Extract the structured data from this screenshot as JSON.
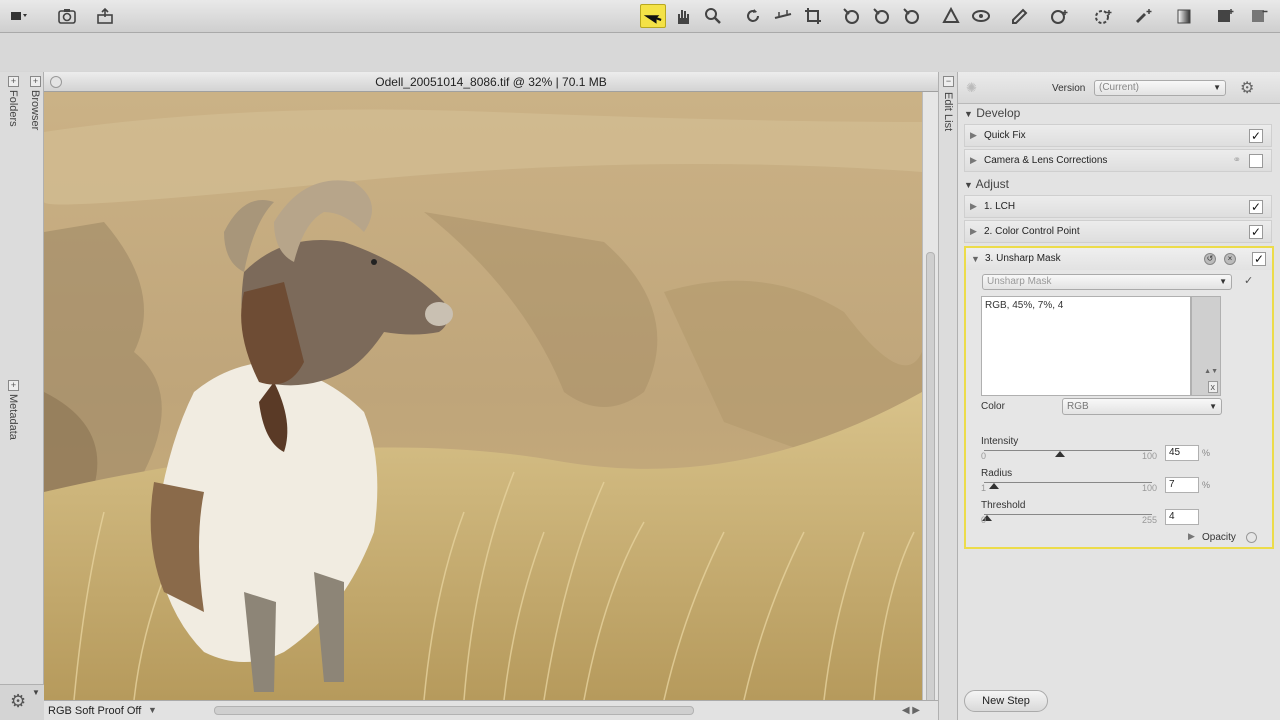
{
  "toolbar": {
    "left_icons": [
      "view-mode-icon",
      "snapshot-icon",
      "print-icon"
    ],
    "tools": [
      "direct-selection-tool-icon",
      "hand-tool-icon",
      "zoom-tool-icon",
      "rotate-tool-icon",
      "straighten-tool-icon",
      "crop-tool-icon",
      "red-eye-tool-icon",
      "auto-retouch-icon",
      "retouch-brush-icon",
      "black-control-point-icon",
      "neutral-control-point-icon",
      "white-control-point-icon",
      "color-picker-icon",
      "color-control-point-icon",
      "lasso-selection-icon",
      "brush-selection-icon",
      "gradient-selection-icon",
      "fill-remove-icon"
    ],
    "accent_color": "#f4e247"
  },
  "left_panel": {
    "tabs": [
      "Folders",
      "Browser",
      "Metadata"
    ]
  },
  "image_window": {
    "title": "Odell_20051014_8086.tif @ 32% | 70.1 MB",
    "status": "RGB  Soft Proof Off"
  },
  "edit_list_tab": "Edit List",
  "right_panel": {
    "version_label": "Version",
    "version_value": "(Current)",
    "develop_label": "Develop",
    "develop_items": [
      {
        "label": "Quick Fix",
        "checked": "✓"
      },
      {
        "label": "Camera & Lens Corrections",
        "checked": ""
      }
    ],
    "adjust_label": "Adjust",
    "adjust_items": [
      {
        "label": "1. LCH",
        "checked": "✓"
      },
      {
        "label": "2. Color Control Point",
        "checked": "✓"
      },
      {
        "label": "3. Unsharp Mask",
        "checked": "✓"
      }
    ],
    "unsharp": {
      "filter": "Unsharp Mask",
      "summary": "RGB, 45%, 7%, 4",
      "color_label": "Color",
      "color_value": "RGB",
      "intensity": {
        "label": "Intensity",
        "min": "0",
        "max": "100",
        "value": "45",
        "unit": "%",
        "fraction": 0.45
      },
      "radius": {
        "label": "Radius",
        "min": "1",
        "max": "100",
        "value": "7",
        "unit": "%",
        "fraction": 0.06
      },
      "threshold": {
        "label": "Threshold",
        "min": "0",
        "max": "255",
        "value": "4",
        "fraction": 0.016
      },
      "opacity_label": "Opacity"
    },
    "new_step": "New Step"
  }
}
